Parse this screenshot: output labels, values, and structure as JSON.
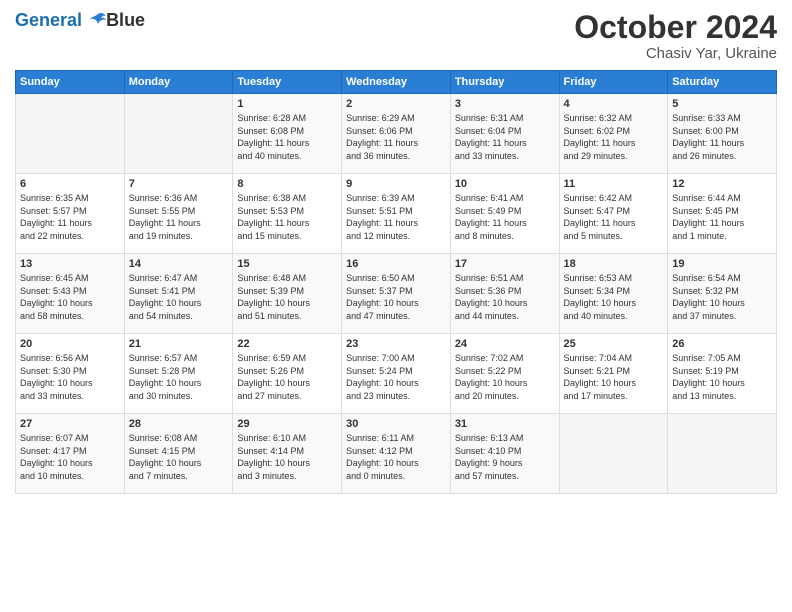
{
  "header": {
    "logo_line1": "General",
    "logo_line2": "Blue",
    "month": "October 2024",
    "location": "Chasiv Yar, Ukraine"
  },
  "days_of_week": [
    "Sunday",
    "Monday",
    "Tuesday",
    "Wednesday",
    "Thursday",
    "Friday",
    "Saturday"
  ],
  "weeks": [
    [
      {
        "num": "",
        "detail": ""
      },
      {
        "num": "",
        "detail": ""
      },
      {
        "num": "1",
        "detail": "Sunrise: 6:28 AM\nSunset: 6:08 PM\nDaylight: 11 hours\nand 40 minutes."
      },
      {
        "num": "2",
        "detail": "Sunrise: 6:29 AM\nSunset: 6:06 PM\nDaylight: 11 hours\nand 36 minutes."
      },
      {
        "num": "3",
        "detail": "Sunrise: 6:31 AM\nSunset: 6:04 PM\nDaylight: 11 hours\nand 33 minutes."
      },
      {
        "num": "4",
        "detail": "Sunrise: 6:32 AM\nSunset: 6:02 PM\nDaylight: 11 hours\nand 29 minutes."
      },
      {
        "num": "5",
        "detail": "Sunrise: 6:33 AM\nSunset: 6:00 PM\nDaylight: 11 hours\nand 26 minutes."
      }
    ],
    [
      {
        "num": "6",
        "detail": "Sunrise: 6:35 AM\nSunset: 5:57 PM\nDaylight: 11 hours\nand 22 minutes."
      },
      {
        "num": "7",
        "detail": "Sunrise: 6:36 AM\nSunset: 5:55 PM\nDaylight: 11 hours\nand 19 minutes."
      },
      {
        "num": "8",
        "detail": "Sunrise: 6:38 AM\nSunset: 5:53 PM\nDaylight: 11 hours\nand 15 minutes."
      },
      {
        "num": "9",
        "detail": "Sunrise: 6:39 AM\nSunset: 5:51 PM\nDaylight: 11 hours\nand 12 minutes."
      },
      {
        "num": "10",
        "detail": "Sunrise: 6:41 AM\nSunset: 5:49 PM\nDaylight: 11 hours\nand 8 minutes."
      },
      {
        "num": "11",
        "detail": "Sunrise: 6:42 AM\nSunset: 5:47 PM\nDaylight: 11 hours\nand 5 minutes."
      },
      {
        "num": "12",
        "detail": "Sunrise: 6:44 AM\nSunset: 5:45 PM\nDaylight: 11 hours\nand 1 minute."
      }
    ],
    [
      {
        "num": "13",
        "detail": "Sunrise: 6:45 AM\nSunset: 5:43 PM\nDaylight: 10 hours\nand 58 minutes."
      },
      {
        "num": "14",
        "detail": "Sunrise: 6:47 AM\nSunset: 5:41 PM\nDaylight: 10 hours\nand 54 minutes."
      },
      {
        "num": "15",
        "detail": "Sunrise: 6:48 AM\nSunset: 5:39 PM\nDaylight: 10 hours\nand 51 minutes."
      },
      {
        "num": "16",
        "detail": "Sunrise: 6:50 AM\nSunset: 5:37 PM\nDaylight: 10 hours\nand 47 minutes."
      },
      {
        "num": "17",
        "detail": "Sunrise: 6:51 AM\nSunset: 5:36 PM\nDaylight: 10 hours\nand 44 minutes."
      },
      {
        "num": "18",
        "detail": "Sunrise: 6:53 AM\nSunset: 5:34 PM\nDaylight: 10 hours\nand 40 minutes."
      },
      {
        "num": "19",
        "detail": "Sunrise: 6:54 AM\nSunset: 5:32 PM\nDaylight: 10 hours\nand 37 minutes."
      }
    ],
    [
      {
        "num": "20",
        "detail": "Sunrise: 6:56 AM\nSunset: 5:30 PM\nDaylight: 10 hours\nand 33 minutes."
      },
      {
        "num": "21",
        "detail": "Sunrise: 6:57 AM\nSunset: 5:28 PM\nDaylight: 10 hours\nand 30 minutes."
      },
      {
        "num": "22",
        "detail": "Sunrise: 6:59 AM\nSunset: 5:26 PM\nDaylight: 10 hours\nand 27 minutes."
      },
      {
        "num": "23",
        "detail": "Sunrise: 7:00 AM\nSunset: 5:24 PM\nDaylight: 10 hours\nand 23 minutes."
      },
      {
        "num": "24",
        "detail": "Sunrise: 7:02 AM\nSunset: 5:22 PM\nDaylight: 10 hours\nand 20 minutes."
      },
      {
        "num": "25",
        "detail": "Sunrise: 7:04 AM\nSunset: 5:21 PM\nDaylight: 10 hours\nand 17 minutes."
      },
      {
        "num": "26",
        "detail": "Sunrise: 7:05 AM\nSunset: 5:19 PM\nDaylight: 10 hours\nand 13 minutes."
      }
    ],
    [
      {
        "num": "27",
        "detail": "Sunrise: 6:07 AM\nSunset: 4:17 PM\nDaylight: 10 hours\nand 10 minutes."
      },
      {
        "num": "28",
        "detail": "Sunrise: 6:08 AM\nSunset: 4:15 PM\nDaylight: 10 hours\nand 7 minutes."
      },
      {
        "num": "29",
        "detail": "Sunrise: 6:10 AM\nSunset: 4:14 PM\nDaylight: 10 hours\nand 3 minutes."
      },
      {
        "num": "30",
        "detail": "Sunrise: 6:11 AM\nSunset: 4:12 PM\nDaylight: 10 hours\nand 0 minutes."
      },
      {
        "num": "31",
        "detail": "Sunrise: 6:13 AM\nSunset: 4:10 PM\nDaylight: 9 hours\nand 57 minutes."
      },
      {
        "num": "",
        "detail": ""
      },
      {
        "num": "",
        "detail": ""
      }
    ]
  ]
}
